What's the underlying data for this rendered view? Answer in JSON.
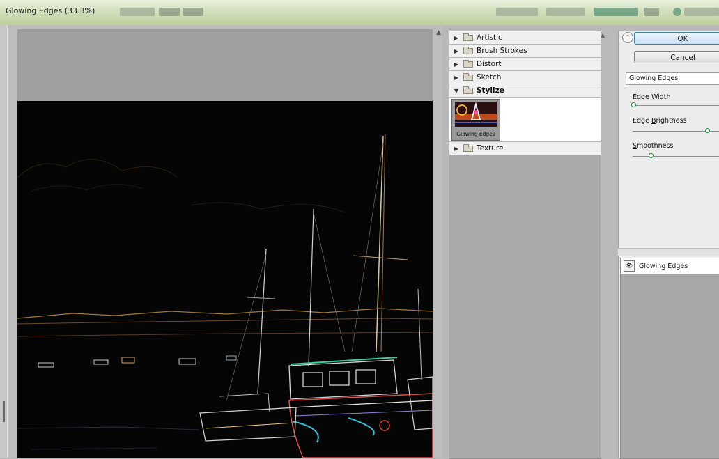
{
  "window": {
    "title": "Glowing Edges (33.3%)"
  },
  "filters": {
    "categories": [
      {
        "label": "Artistic",
        "expanded": false
      },
      {
        "label": "Brush Strokes",
        "expanded": false
      },
      {
        "label": "Distort",
        "expanded": false
      },
      {
        "label": "Sketch",
        "expanded": false
      },
      {
        "label": "Stylize",
        "expanded": true
      },
      {
        "label": "Texture",
        "expanded": false
      }
    ],
    "selected_thumbnail": {
      "label": "Glowing Edges"
    }
  },
  "panel": {
    "ok_label": "OK",
    "cancel_label": "Cancel",
    "selected_filter": "Glowing Edges",
    "params": [
      {
        "label": "Edge Width",
        "mnemonic": "E",
        "rest": "dge Width",
        "fraction": 0.02
      },
      {
        "label": "Edge Brightness",
        "mnemonic": "B",
        "pre": "Edge ",
        "rest": "rightness",
        "fraction": 0.85
      },
      {
        "label": "Smoothness",
        "mnemonic": "S",
        "rest": "moothness",
        "fraction": 0.2
      }
    ]
  },
  "effect_layers": [
    {
      "label": "Glowing Edges",
      "visible": true
    }
  ],
  "colors": {
    "ok_border": "#3c7fb1",
    "slider_thumb": "#1e8a3a",
    "preview_background": "#050505"
  }
}
